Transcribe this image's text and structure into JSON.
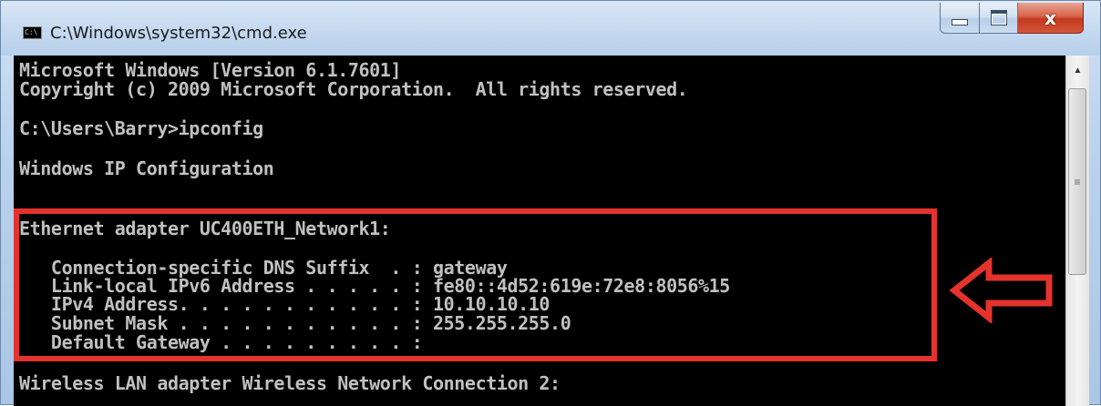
{
  "window": {
    "title": "C:\\Windows\\system32\\cmd.exe",
    "icon_text": "C:\\",
    "close_glyph": "x"
  },
  "console": {
    "lines": [
      "Microsoft Windows [Version 6.1.7601]",
      "Copyright (c) 2009 Microsoft Corporation.  All rights reserved.",
      "C:\\Users\\Barry>ipconfig",
      "Windows IP Configuration",
      "Ethernet adapter UC400ETH_Network1:",
      "   Connection-specific DNS Suffix  . : gateway",
      "   Link-local IPv6 Address . . . . . : fe80::4d52:619e:72e8:8056%15",
      "   IPv4 Address. . . . . . . . . . . : 10.10.10.10",
      "   Subnet Mask . . . . . . . . . . . : 255.255.255.0",
      "   Default Gateway . . . . . . . . . :",
      "Wireless LAN adapter Wireless Network Connection 2:"
    ]
  },
  "annotation": {
    "highlight_color": "#e4322d",
    "arrow_icon": "left-arrow-icon"
  },
  "colors": {
    "console_bg": "#000000",
    "console_text": "#c0c0c0"
  }
}
